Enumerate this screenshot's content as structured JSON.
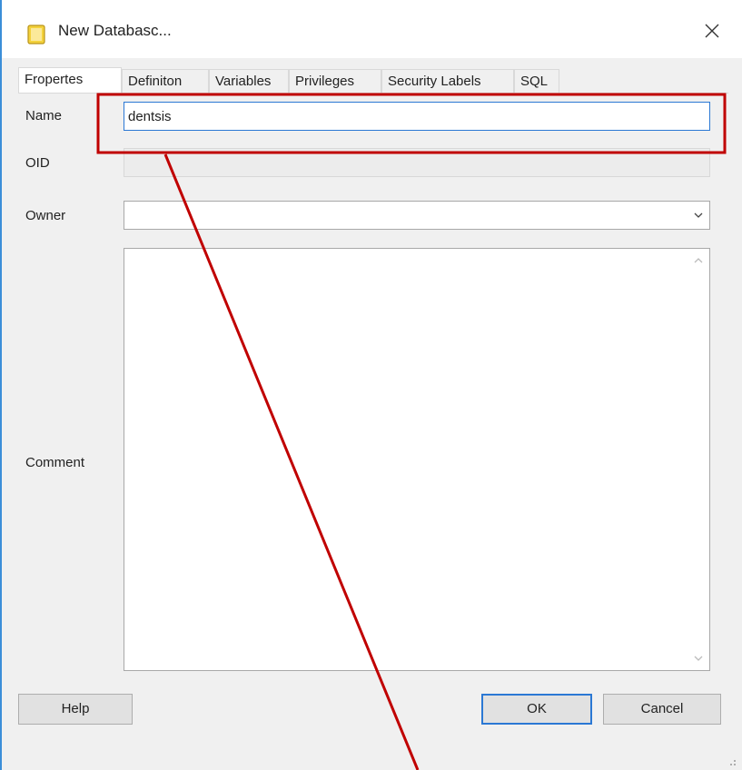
{
  "window": {
    "title": "New Databasc..."
  },
  "tabs": [
    {
      "label": "Fropertes"
    },
    {
      "label": "Definiton"
    },
    {
      "label": "Variables"
    },
    {
      "label": "Privileges"
    },
    {
      "label": "Security Labels"
    },
    {
      "label": "SQL"
    }
  ],
  "form": {
    "name_label": "Name",
    "name_value": "dentsis",
    "oid_label": "OID",
    "oid_value": "",
    "owner_label": "Owner",
    "owner_value": "",
    "comment_label": "Comment",
    "comment_value": ""
  },
  "buttons": {
    "help": "Help",
    "ok": "OK",
    "cancel": "Cancel"
  },
  "annotation": {
    "color": "#c00000"
  }
}
